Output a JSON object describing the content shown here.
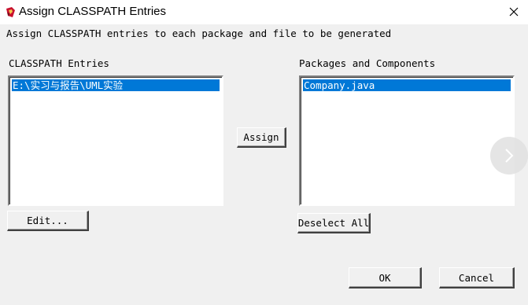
{
  "window": {
    "title": "Assign CLASSPATH Entries",
    "icon": "app-icon",
    "close_icon": "close-icon"
  },
  "instructions": "Assign CLASSPATH entries to each package and file to be generated",
  "classpath": {
    "label": "CLASSPATH Entries",
    "items": [
      "E:\\实习与报告\\UML实验"
    ]
  },
  "packages": {
    "label": "Packages and Components",
    "items": [
      "Company.java"
    ]
  },
  "buttons": {
    "assign": "Assign",
    "edit": "Edit...",
    "deselect_all": "Deselect All",
    "ok": "OK",
    "cancel": "Cancel"
  },
  "overlay": {
    "next_icon": "chevron-right-icon"
  },
  "colors": {
    "selection": "#0078d7",
    "dialog_bg": "#f0f0f0"
  }
}
